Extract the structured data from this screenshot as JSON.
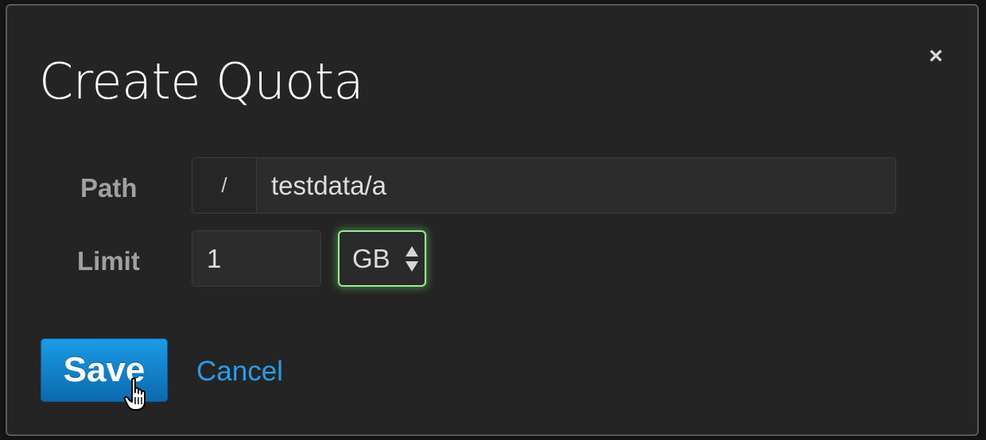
{
  "dialog": {
    "title": "Create Quota",
    "close_label": "×"
  },
  "form": {
    "path": {
      "label": "Path",
      "prefix": "/",
      "value": "testdata/a"
    },
    "limit": {
      "label": "Limit",
      "value": "1",
      "unit": "GB"
    }
  },
  "actions": {
    "save_label": "Save",
    "cancel_label": "Cancel"
  },
  "colors": {
    "primary_button": "#0a6aad",
    "link": "#2a9be6",
    "focus_ring": "#9be89b",
    "dialog_background": "#242424"
  }
}
